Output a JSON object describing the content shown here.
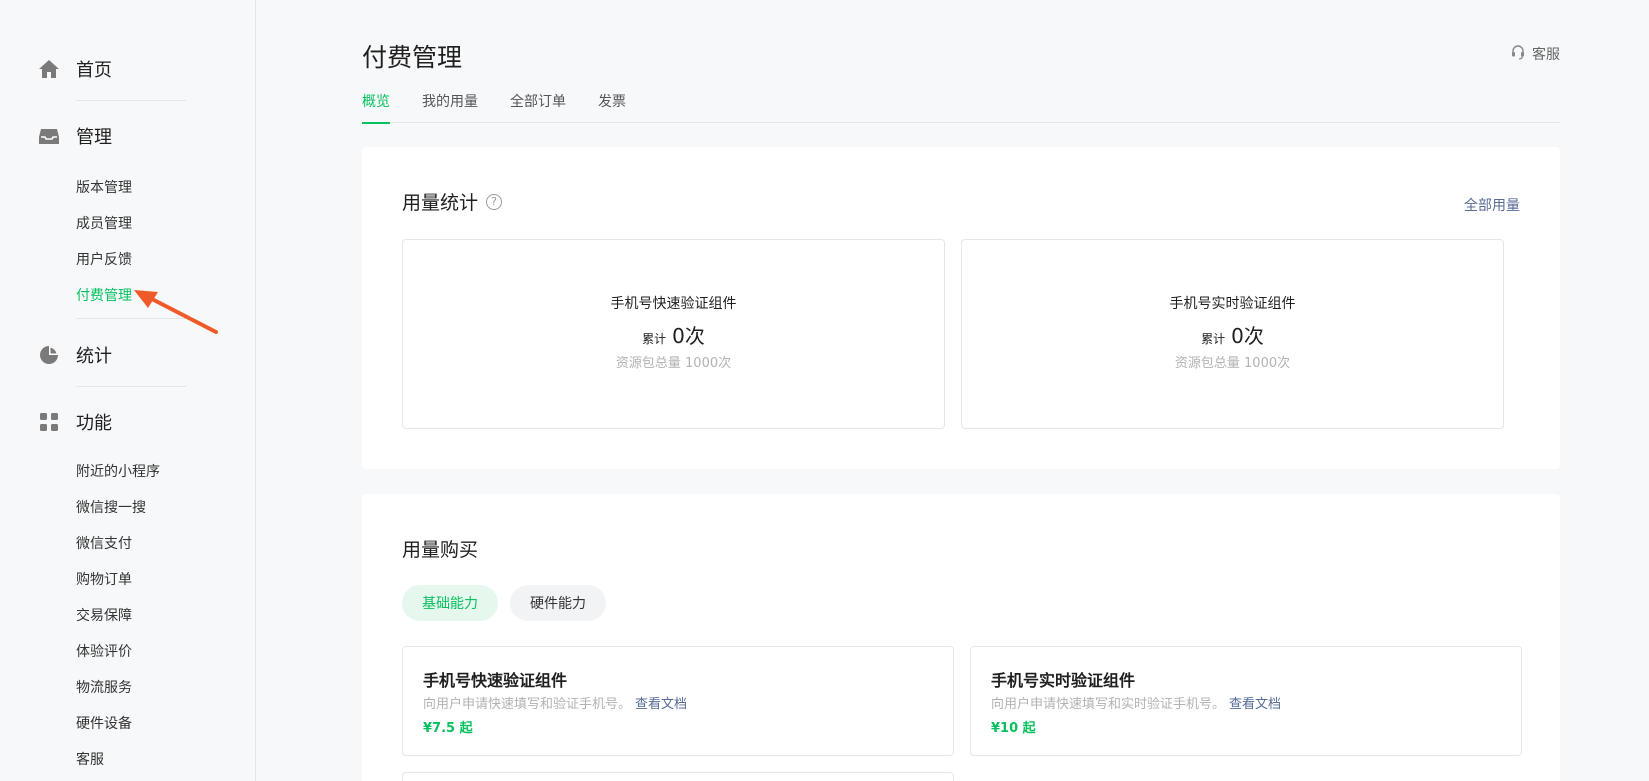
{
  "sidebar": {
    "home": {
      "label": "首页",
      "icon": "home-icon"
    },
    "manage": {
      "label": "管理",
      "icon": "inbox-icon",
      "items": [
        "版本管理",
        "成员管理",
        "用户反馈",
        "付费管理"
      ],
      "active_index": 3
    },
    "stats": {
      "label": "统计",
      "icon": "pie-chart-icon"
    },
    "features": {
      "label": "功能",
      "icon": "grid-icon",
      "items": [
        "附近的小程序",
        "微信搜一搜",
        "微信支付",
        "购物订单",
        "交易保障",
        "体验评价",
        "物流服务",
        "硬件设备",
        "客服"
      ]
    }
  },
  "header": {
    "title": "付费管理",
    "service_label": "客服",
    "service_icon": "headset-icon"
  },
  "tabs": [
    "概览",
    "我的用量",
    "全部订单",
    "发票"
  ],
  "active_tab": 0,
  "usage": {
    "title": "用量统计",
    "help_icon": "question-circle-icon",
    "all_link": "全部用量",
    "stats": [
      {
        "name": "手机号快速验证组件",
        "prefix": "累计",
        "count": "0次",
        "total": "资源包总量 1000次"
      },
      {
        "name": "手机号实时验证组件",
        "prefix": "累计",
        "count": "0次",
        "total": "资源包总量 1000次"
      }
    ]
  },
  "purchase": {
    "title": "用量购买",
    "pills": [
      "基础能力",
      "硬件能力"
    ],
    "active_pill": 0,
    "products": [
      {
        "name": "手机号快速验证组件",
        "desc": "向用户申请快速填写和验证手机号。",
        "link": "查看文档",
        "price": "¥7.5 起"
      },
      {
        "name": "手机号实时验证组件",
        "desc": "向用户申请快速填写和实时验证手机号。",
        "link": "查看文档",
        "price": "¥10 起"
      }
    ]
  },
  "colors": {
    "accent": "#07c160",
    "link": "#576b95",
    "annotation_arrow": "#f05a28"
  }
}
